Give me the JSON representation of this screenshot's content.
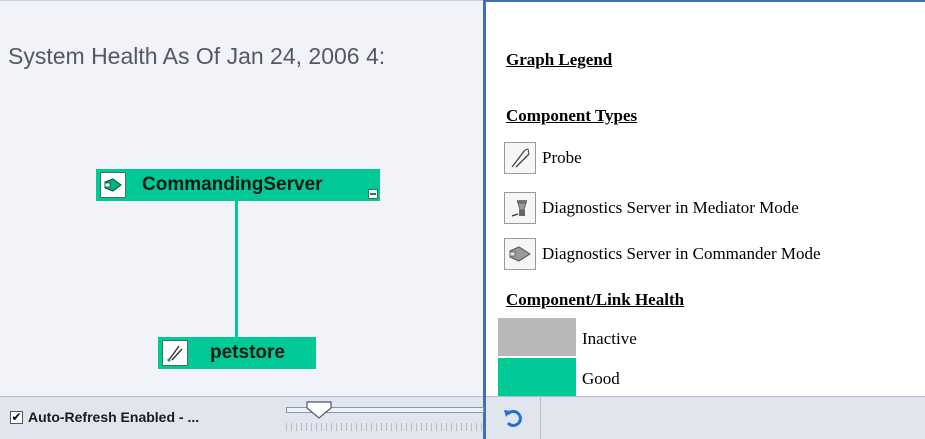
{
  "graph": {
    "title": "System Health As Of Jan 24, 2006 4:",
    "nodes": [
      {
        "label": "CommandingServer",
        "icon": "commander-icon",
        "health": "Good"
      },
      {
        "label": "petstore",
        "icon": "probe-icon",
        "health": "Good"
      }
    ]
  },
  "legend": {
    "title": "Graph Legend",
    "types_heading": "Component Types",
    "types": [
      {
        "label": "Probe",
        "icon": "probe-icon"
      },
      {
        "label": "Diagnostics Server in Mediator Mode",
        "icon": "mediator-icon"
      },
      {
        "label": "Diagnostics Server in Commander Mode",
        "icon": "commander-icon"
      }
    ],
    "health_heading": "Component/Link Health",
    "health": [
      {
        "label": "Inactive",
        "color": "#b8b8b8"
      },
      {
        "label": "Good",
        "color": "#00c896"
      }
    ]
  },
  "toolbar": {
    "auto_refresh_label": "Auto-Refresh Enabled - ...",
    "auto_refresh_checked": true,
    "refresh_icon": "refresh-icon"
  },
  "colors": {
    "good": "#00c896",
    "inactive": "#b8b8b8",
    "divider": "#3f6fb4"
  }
}
